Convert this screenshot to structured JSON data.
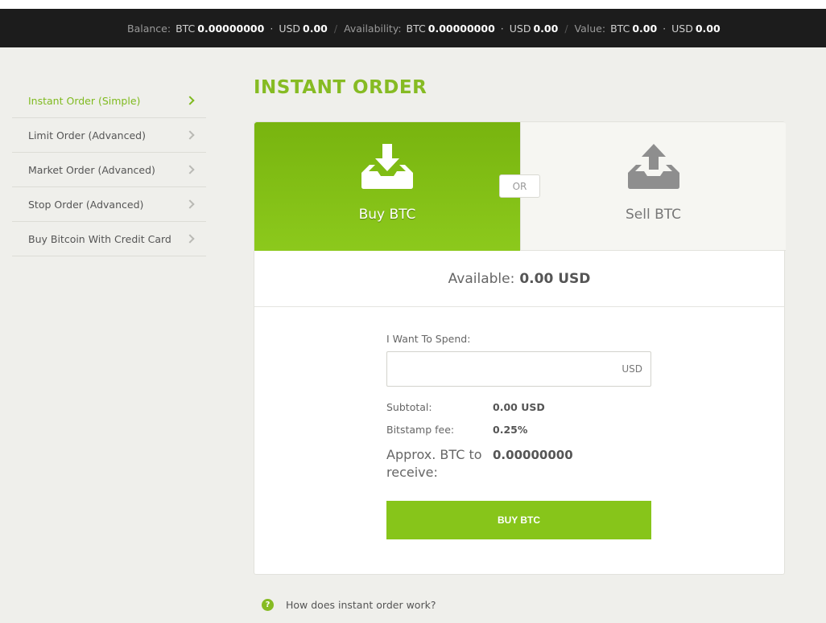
{
  "balance_bar": {
    "balance_label": "Balance:",
    "balance_btc_cur": "BTC",
    "balance_btc": "0.00000000",
    "balance_usd_cur": "USD",
    "balance_usd": "0.00",
    "availability_label": "Availability:",
    "availability_btc_cur": "BTC",
    "availability_btc": "0.00000000",
    "availability_usd_cur": "USD",
    "availability_usd": "0.00",
    "value_label": "Value:",
    "value_btc_cur": "BTC",
    "value_btc": "0.00",
    "value_usd_cur": "USD",
    "value_usd": "0.00"
  },
  "sidebar": {
    "items": [
      {
        "label": "Instant Order (Simple)",
        "active": true
      },
      {
        "label": "Limit Order (Advanced)",
        "active": false
      },
      {
        "label": "Market Order (Advanced)",
        "active": false
      },
      {
        "label": "Stop Order (Advanced)",
        "active": false
      },
      {
        "label": "Buy Bitcoin With Credit Card",
        "active": false
      }
    ]
  },
  "page": {
    "title": "INSTANT ORDER"
  },
  "order": {
    "buy_label": "Buy BTC",
    "buy_icon": "download-tray-icon",
    "sell_label": "Sell BTC",
    "sell_icon": "upload-tray-icon",
    "or_label": "OR",
    "available_label": "Available:",
    "available_value": "0.00 USD"
  },
  "form": {
    "spend_label": "I Want To Spend:",
    "amount_value": "",
    "amount_placeholder": "",
    "amount_unit": "USD",
    "subtotal_label": "Subtotal:",
    "subtotal_value": "0.00 USD",
    "fee_label": "Bitstamp fee:",
    "fee_value": "0.25%",
    "approx_label": "Approx. BTC to receive:",
    "approx_value": "0.00000000",
    "submit_label": "BUY BTC"
  },
  "help": {
    "icon": "question-circle-icon",
    "glyph": "?",
    "text": "How does instant order work?"
  },
  "colors": {
    "accent": "#86bb23",
    "topbar": "#1c1c1c",
    "background": "#efefeb"
  }
}
